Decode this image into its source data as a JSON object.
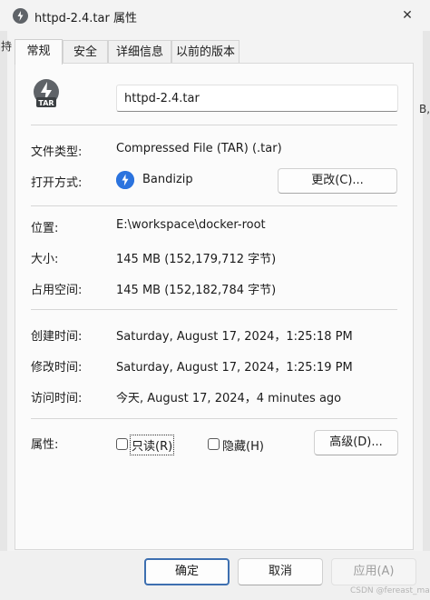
{
  "window": {
    "title": "httpd-2.4.tar 属性",
    "close_label": "✕"
  },
  "background_fragments": {
    "left": "持",
    "right": "B,"
  },
  "tabs": [
    {
      "label": "常规",
      "active": true
    },
    {
      "label": "安全",
      "active": false
    },
    {
      "label": "详细信息",
      "active": false
    },
    {
      "label": "以前的版本",
      "active": false
    }
  ],
  "file": {
    "icon_badge": "TAR",
    "name": "httpd-2.4.tar"
  },
  "file_type": {
    "label": "文件类型:",
    "value": "Compressed File (TAR) (.tar)"
  },
  "opens_with": {
    "label": "打开方式:",
    "app_name": "Bandizip",
    "change_button": "更改(C)..."
  },
  "location": {
    "label": "位置:",
    "value": "E:\\workspace\\docker-root"
  },
  "size": {
    "label": "大小:",
    "value": "145 MB (152,179,712 字节)"
  },
  "size_on_disk": {
    "label": "占用空间:",
    "value": "145 MB (152,182,784 字节)"
  },
  "created": {
    "label": "创建时间:",
    "value": "Saturday, August 17, 2024，1:25:18 PM"
  },
  "modified": {
    "label": "修改时间:",
    "value": "Saturday, August 17, 2024，1:25:19 PM"
  },
  "accessed": {
    "label": "访问时间:",
    "value": "今天, August 17, 2024，4 minutes ago"
  },
  "attributes": {
    "label": "属性:",
    "readonly": {
      "label": "只读(R)",
      "checked": false
    },
    "hidden": {
      "label": "隐藏(H)",
      "checked": false
    },
    "advanced_button": "高级(D)..."
  },
  "footer": {
    "ok": "确定",
    "cancel": "取消",
    "apply": "应用(A)"
  },
  "watermark": "CSDN @fereast_man",
  "colors": {
    "accent_blue": "#2b73de",
    "primary_border": "#3d6fb0"
  }
}
